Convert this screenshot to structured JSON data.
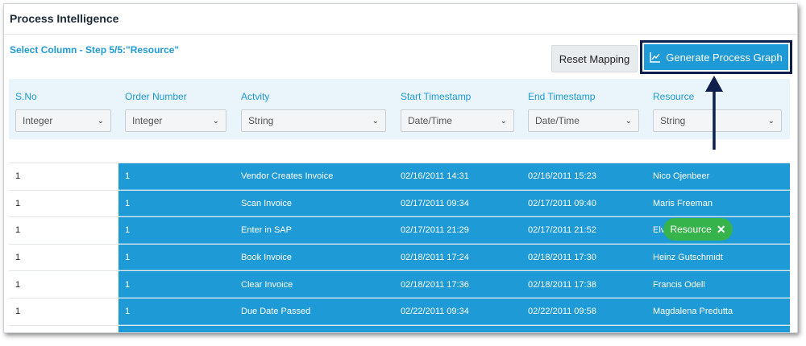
{
  "app": {
    "title": "Process Intelligence"
  },
  "step": {
    "label": "Select Column - Step 5/5:\"Resource\""
  },
  "buttons": {
    "reset": "Reset Mapping",
    "generate": "Generate Process Graph"
  },
  "columns": [
    {
      "header": "S.No",
      "type": "Integer"
    },
    {
      "header": "Order Number",
      "type": "Integer"
    },
    {
      "header": "Actvity",
      "type": "String"
    },
    {
      "header": "Start Timestamp",
      "type": "Date/Time"
    },
    {
      "header": "End Timestamp",
      "type": "Date/Time"
    },
    {
      "header": "Resource",
      "type": "String"
    }
  ],
  "rows": [
    {
      "sno": "1",
      "order": "1",
      "activity": "Vendor Creates Invoice",
      "start": "02/16/2011 14:31",
      "end": "02/16/2011 15:23",
      "resource": "Nico Ojenbeer"
    },
    {
      "sno": "1",
      "order": "1",
      "activity": "Scan Invoice",
      "start": "02/17/2011 09:34",
      "end": "02/17/2011 09:40",
      "resource": "Maris Freeman"
    },
    {
      "sno": "1",
      "order": "1",
      "activity": "Enter in SAP",
      "start": "02/17/2011 21:29",
      "end": "02/17/2011 21:52",
      "resource": "Elvi"
    },
    {
      "sno": "1",
      "order": "1",
      "activity": "Book Invoice",
      "start": "02/18/2011 17:24",
      "end": "02/18/2011 17:30",
      "resource": "Heinz Gutschmidt"
    },
    {
      "sno": "1",
      "order": "1",
      "activity": "Clear Invoice",
      "start": "02/18/2011 17:36",
      "end": "02/18/2011 17:38",
      "resource": "Francis Odell"
    },
    {
      "sno": "1",
      "order": "1",
      "activity": "Due Date Passed",
      "start": "02/22/2011 09:34",
      "end": "02/22/2011 09:58",
      "resource": "Magdalena Predutta"
    }
  ],
  "chip": {
    "label": "Resource",
    "close": "✕"
  },
  "colors": {
    "accent": "#1e9ad6",
    "chip": "#36b34a",
    "highlight_border": "#0d1f4a"
  },
  "icons": {
    "chart": "line-chart-icon",
    "dropdown": "chevron-down-icon",
    "arrow": "arrow-up-icon",
    "close": "close-icon"
  }
}
